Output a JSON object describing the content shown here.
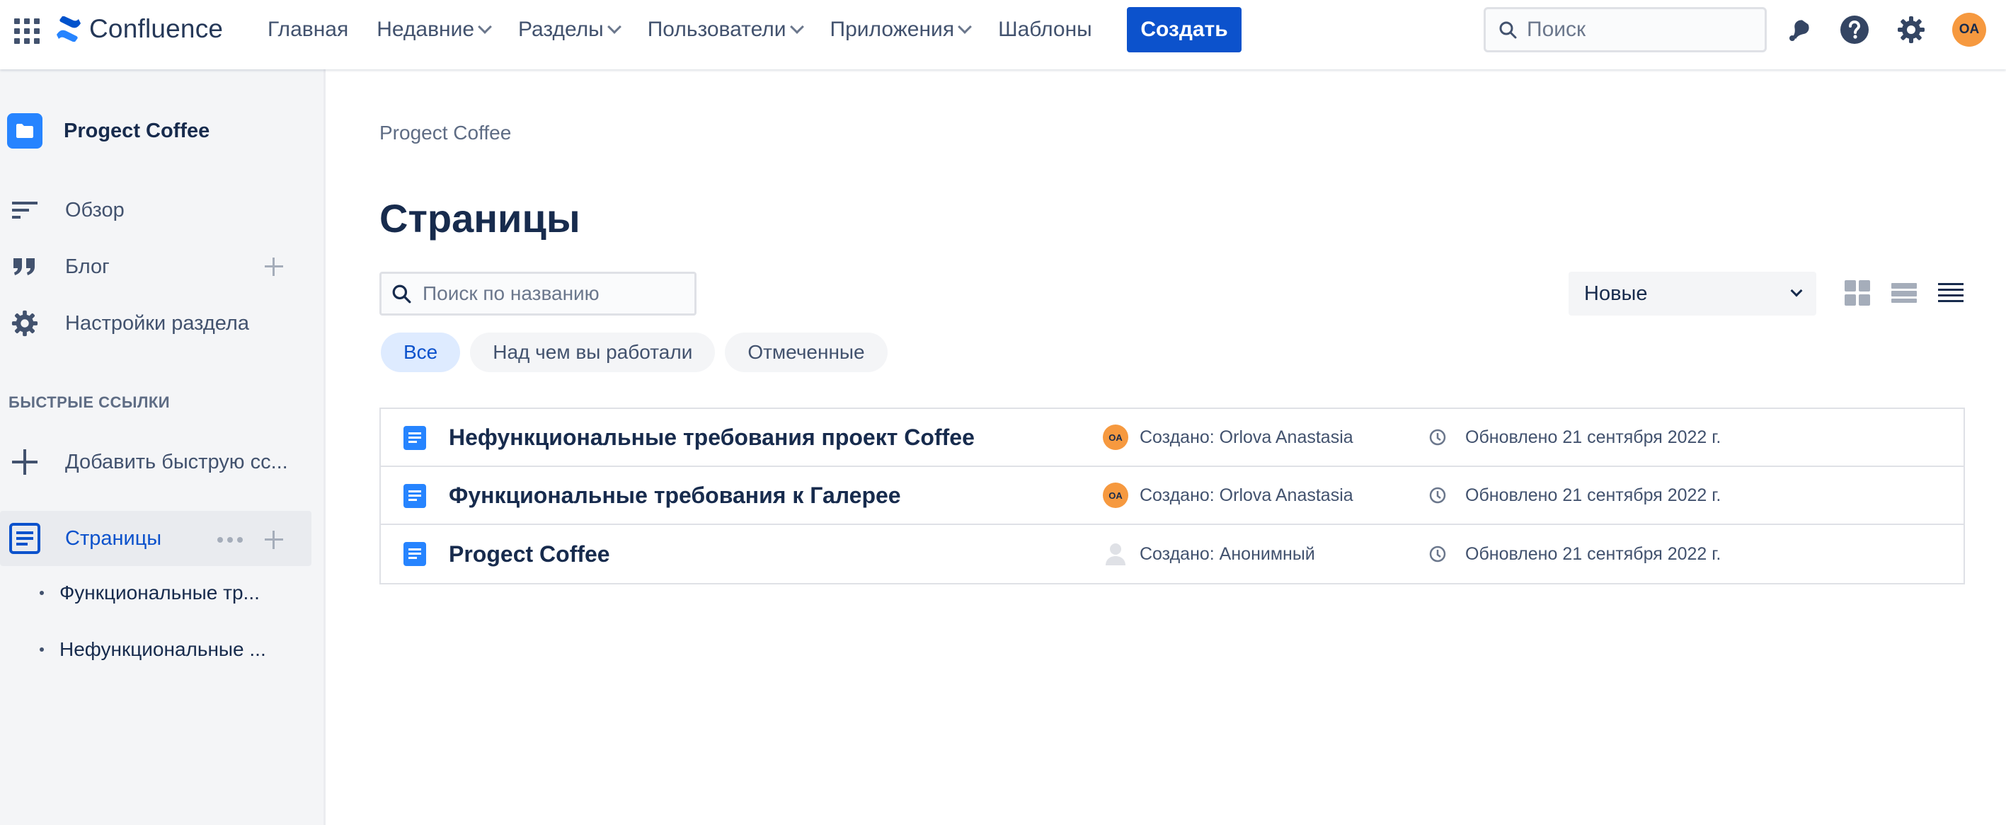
{
  "topbar": {
    "app_name": "Confluence",
    "nav": [
      {
        "label": "Главная",
        "has_dropdown": false
      },
      {
        "label": "Недавние",
        "has_dropdown": true
      },
      {
        "label": "Разделы",
        "has_dropdown": true
      },
      {
        "label": "Пользователи",
        "has_dropdown": true
      },
      {
        "label": "Приложения",
        "has_dropdown": true
      },
      {
        "label": "Шаблоны",
        "has_dropdown": false
      }
    ],
    "create_label": "Создать",
    "search_placeholder": "Поиск",
    "user_initials": "OA",
    "icons": [
      "app-switcher-icon",
      "notifications-icon",
      "help-icon",
      "settings-icon"
    ]
  },
  "sidebar": {
    "space_name": "Progect Coffee",
    "items": [
      {
        "label": "Обзор",
        "icon": "overview-icon"
      },
      {
        "label": "Блог",
        "icon": "quote-icon"
      },
      {
        "label": "Настройки раздела",
        "icon": "gear-icon"
      }
    ],
    "quick_links_title": "БЫСТРЫЕ ССЫЛКИ",
    "add_quick_link": "Добавить быструю сс...",
    "pages_label": "Страницы",
    "tree": [
      "Функциональные тр...",
      "Нефункциональные ..."
    ]
  },
  "main": {
    "breadcrumb": "Progect Coffee",
    "title": "Страницы",
    "filter_placeholder": "Поиск по названию",
    "chips": [
      {
        "label": "Все",
        "active": true
      },
      {
        "label": "Над чем вы работали",
        "active": false
      },
      {
        "label": "Отмеченные",
        "active": false
      }
    ],
    "sort_value": "Новые",
    "view_modes": [
      "grid-view-icon",
      "compact-list-icon",
      "list-view-icon"
    ],
    "rows": [
      {
        "title": "Нефункциональные требования проект Coffee",
        "creator": "Создано: Orlova Anastasia",
        "avatar": "OA",
        "updated": "Обновлено 21 сентября 2022 г."
      },
      {
        "title": "Функциональные требования к Галерее",
        "creator": "Создано: Orlova Anastasia",
        "avatar": "OA",
        "updated": "Обновлено 21 сентября 2022 г."
      },
      {
        "title": "Progect Coffee",
        "creator": "Создано: Анонимный",
        "avatar": "",
        "updated": "Обновлено 21 сентября 2022 г."
      }
    ]
  },
  "colors": {
    "accent": "#0C52CC",
    "avatar": "#F6993F",
    "space_icon": "#2684FF"
  }
}
